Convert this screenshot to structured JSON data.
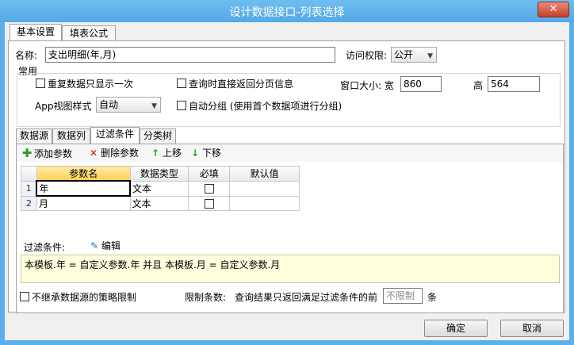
{
  "window": {
    "title": "设计数据接口-列表选择",
    "close_label": "✕"
  },
  "main_tabs": [
    {
      "label": "基本设置",
      "active": true
    },
    {
      "label": "填表公式",
      "active": false
    }
  ],
  "name": {
    "label": "名称:",
    "value": "支出明细(年,月)"
  },
  "access": {
    "label": "访问权限:",
    "value": "公开"
  },
  "common": {
    "title": "常用",
    "show_once_label": "重复数据只显示一次",
    "paging_label": "查询时直接返回分页信息",
    "window_size_label": "窗口大小: 宽",
    "width_value": "860",
    "height_label": "高",
    "height_value": "564",
    "app_view_label": "App视图样式",
    "app_view_value": "自动",
    "auto_group_label": "自动分组 (使用首个数据项进行分组)"
  },
  "sub_tabs": [
    {
      "label": "数据源"
    },
    {
      "label": "数据列"
    },
    {
      "label": "过滤条件"
    },
    {
      "label": "分类树"
    }
  ],
  "toolbar": {
    "add_label": "添加参数",
    "delete_label": "删除参数",
    "up_label": "上移",
    "down_label": "下移"
  },
  "grid": {
    "headers": [
      "参数名",
      "数据类型",
      "必填",
      "默认值"
    ],
    "rows": [
      {
        "num": "1",
        "name": "年",
        "type": "文本"
      },
      {
        "num": "2",
        "name": "月",
        "type": "文本"
      }
    ]
  },
  "filter": {
    "label": "过滤条件:",
    "edit_label": "编辑",
    "expression": "本模板.年 = 自定义参数.年 并且 本模板.月 = 自定义参数.月"
  },
  "bottom": {
    "no_inherit_label": "不继承数据源的策略限制",
    "limit_label": "限制条数:",
    "limit_desc": "查询结果只返回满足过滤条件的前",
    "limit_value": "不限制",
    "limit_unit": "条"
  },
  "buttons": {
    "ok": "确定",
    "cancel": "取消"
  },
  "colors": {
    "title_bar": "#5ab0ea",
    "filter_bg": "#ffffdd",
    "header_selected": "#ffcf55",
    "add_icon": "#2a9d2a",
    "delete_icon": "#d01010"
  }
}
